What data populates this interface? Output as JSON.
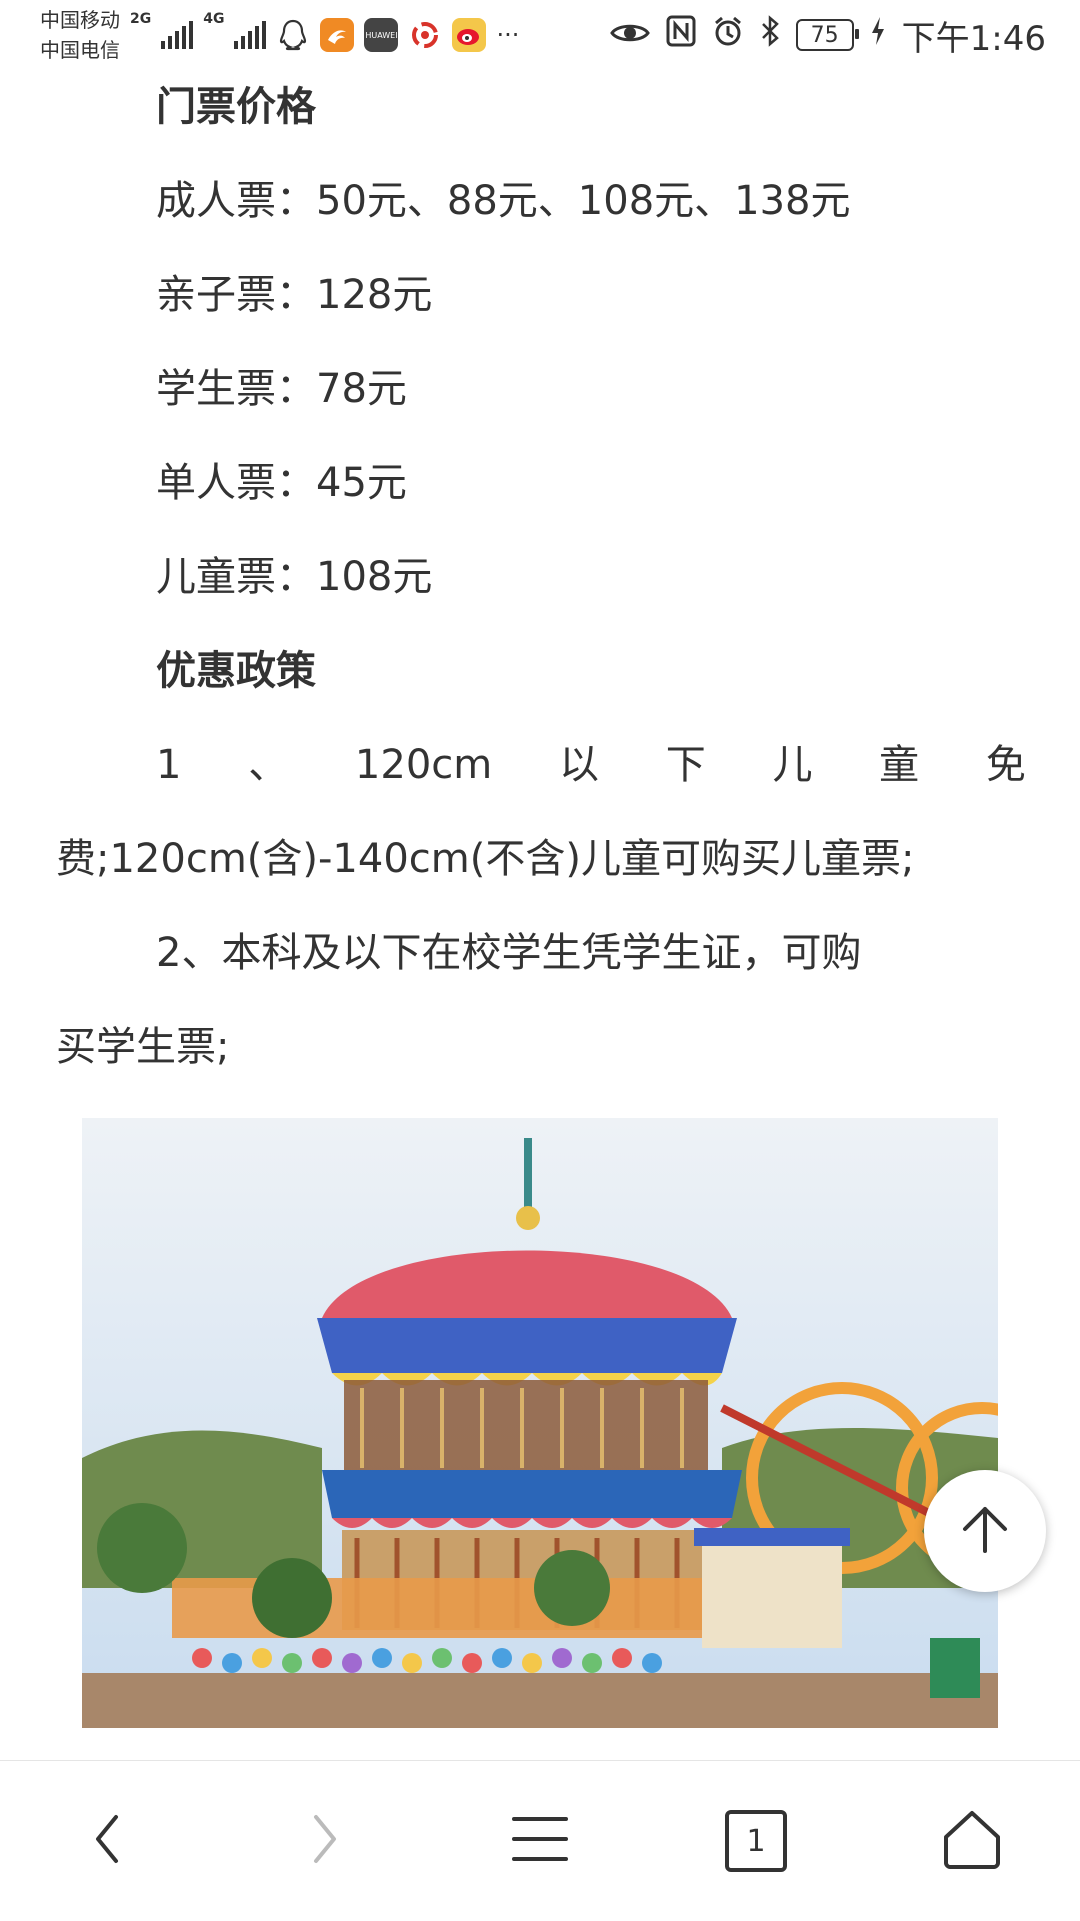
{
  "status_bar": {
    "carrier1": "中国移动",
    "carrier2": "中国电信",
    "net1": "2G",
    "net2": "4G",
    "battery": "75",
    "time": "下午1:46",
    "huawei_label": "HUAWEI",
    "more": "···"
  },
  "article": {
    "section_price_title": "门票价格",
    "tickets": [
      {
        "text": "成人票：50元、88元、108元、138元"
      },
      {
        "text": "亲子票：128元"
      },
      {
        "text": "学生票：78元"
      },
      {
        "text": "单人票：45元"
      },
      {
        "text": "儿童票：108元"
      }
    ],
    "section_discount_title": "优惠政策",
    "discount1_tokens": [
      "1",
      "、",
      "120cm",
      "以",
      "下",
      "儿",
      "童",
      "免"
    ],
    "discount1_line2": "费;120cm(含)-140cm(不含)儿童可购买儿童票;",
    "discount2_line1": "2、本科及以下在校学生凭学生证，可购",
    "discount2_line2": "买学生票;"
  },
  "bottom_nav": {
    "tab_count": "1"
  },
  "colors": {
    "text": "#333333",
    "sky": "#c9dcef",
    "accent_orange": "#f2a23a"
  }
}
